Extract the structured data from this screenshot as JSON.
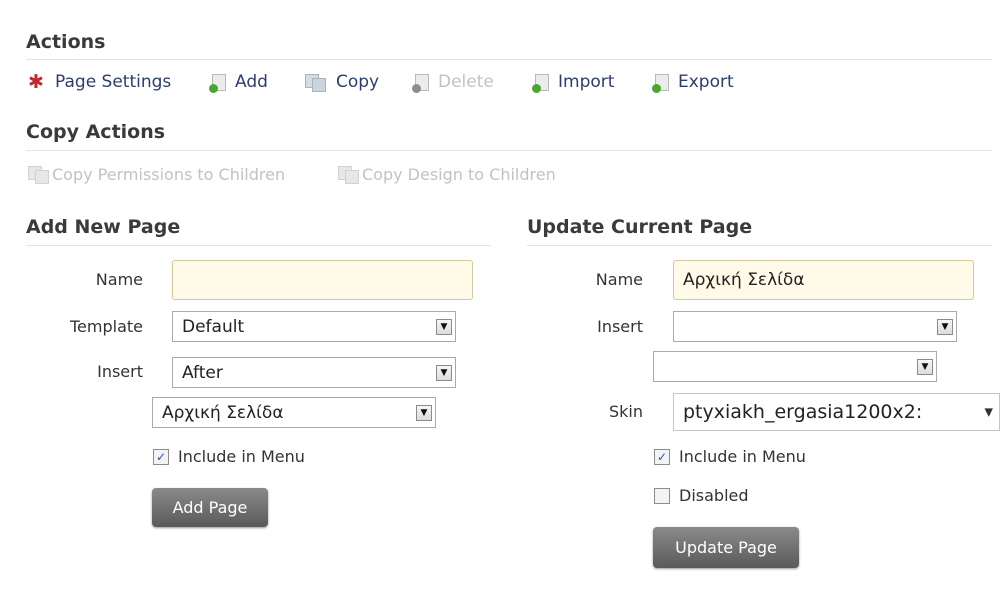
{
  "actions": {
    "title": "Actions",
    "items": {
      "page_settings": "Page Settings",
      "add": "Add",
      "copy": "Copy",
      "delete": "Delete",
      "import": "Import",
      "export": "Export"
    }
  },
  "copy_actions": {
    "title": "Copy Actions",
    "copy_permissions": "Copy Permissions to Children",
    "copy_design": "Copy Design to Children"
  },
  "add_page": {
    "title": "Add New Page",
    "name_label": "Name",
    "name_value": "",
    "template_label": "Template",
    "template_value": "Default",
    "insert_label": "Insert",
    "insert_value": "After",
    "page_value": "Αρχική Σελίδα",
    "include_menu_label": "Include in Menu",
    "include_menu_checked": true,
    "button_label": "Add Page"
  },
  "update_page": {
    "title": "Update Current Page",
    "name_label": "Name",
    "name_value": "Αρχική Σελίδα",
    "insert_label": "Insert",
    "insert_value": "",
    "page_value": "",
    "skin_label": "Skin",
    "skin_value": "ptyxiakh_ergasia1200x2:",
    "include_menu_label": "Include in Menu",
    "include_menu_checked": true,
    "disabled_label": "Disabled",
    "disabled_checked": false,
    "button_label": "Update Page"
  },
  "colors": {
    "link": "#2c3d6b",
    "disabled": "#c2c2c2",
    "button": "#6e6e6e",
    "input_highlight": "#fffbe8"
  }
}
